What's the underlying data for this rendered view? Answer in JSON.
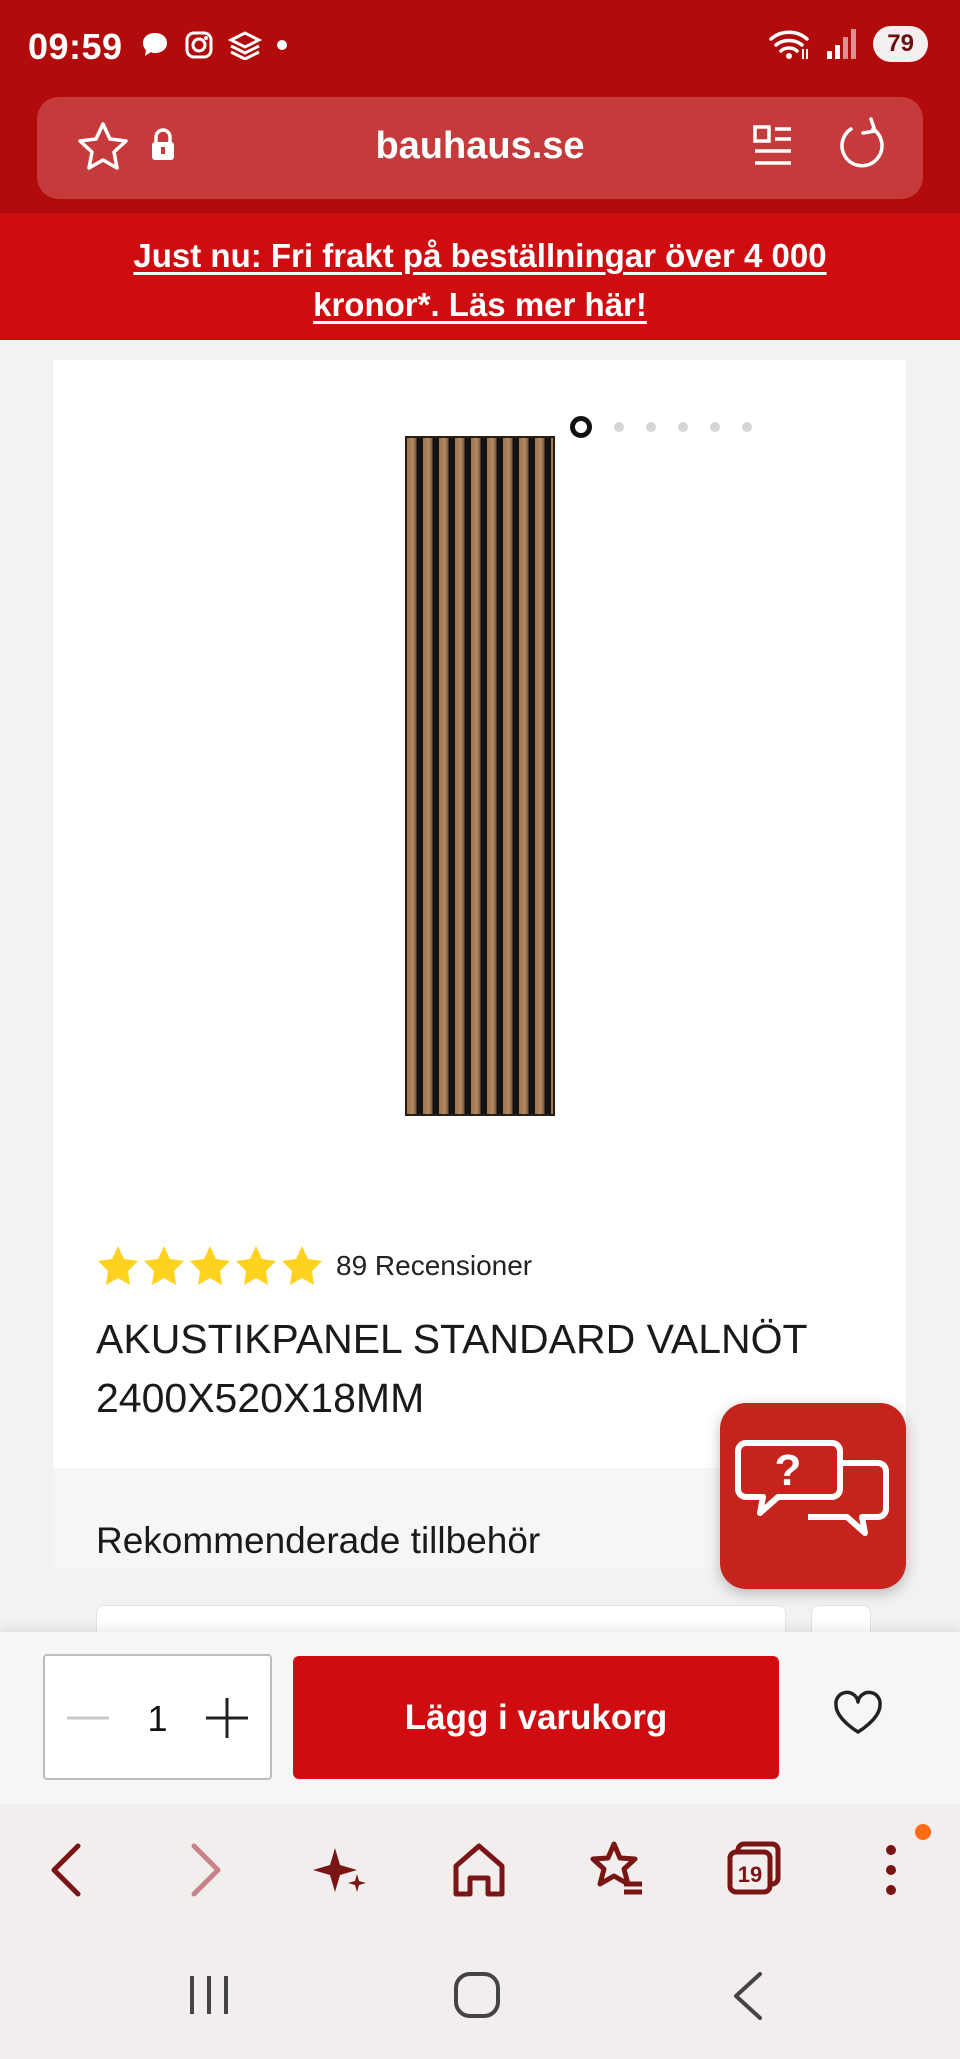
{
  "status_bar": {
    "time": "09:59",
    "battery": "79",
    "left_icons": [
      "chat-bubble-icon",
      "instagram-icon",
      "app-icon",
      "dot-icon"
    ],
    "right_icons": [
      "wifi-icon",
      "signal-icon",
      "battery-icon"
    ]
  },
  "browser": {
    "url": "bauhaus.se",
    "icons": [
      "star-icon",
      "lock-icon",
      "reader-icon",
      "reload-icon"
    ]
  },
  "promo": {
    "line1": "Just nu: Fri frakt på beställningar över 4 000",
    "line2": "kronor*. Läs mer här!"
  },
  "product": {
    "image_count": 6,
    "active_image": 1,
    "rating": 5,
    "reviews": "89 Recensioner",
    "title_line1": "AKUSTIKPANEL STANDARD VALNÖT",
    "title_line2": "2400X520X18MM"
  },
  "recommended": {
    "heading": "Rekommenderade tillbehör"
  },
  "purchase": {
    "quantity": "1",
    "add_to_cart": "Lägg i varukorg"
  },
  "browser_nav": {
    "tab_count": "19",
    "icons": [
      "back-icon",
      "forward-icon",
      "sparkle-icon",
      "home-icon",
      "bookmarks-icon",
      "tabs-icon",
      "menu-icon"
    ]
  },
  "colors": {
    "brand_red": "#cf0d10",
    "statusbar_red": "#b20b0b",
    "star_yellow": "#ffd21f",
    "chat_red": "#c5241c",
    "nav_icon": "#7a1515"
  }
}
